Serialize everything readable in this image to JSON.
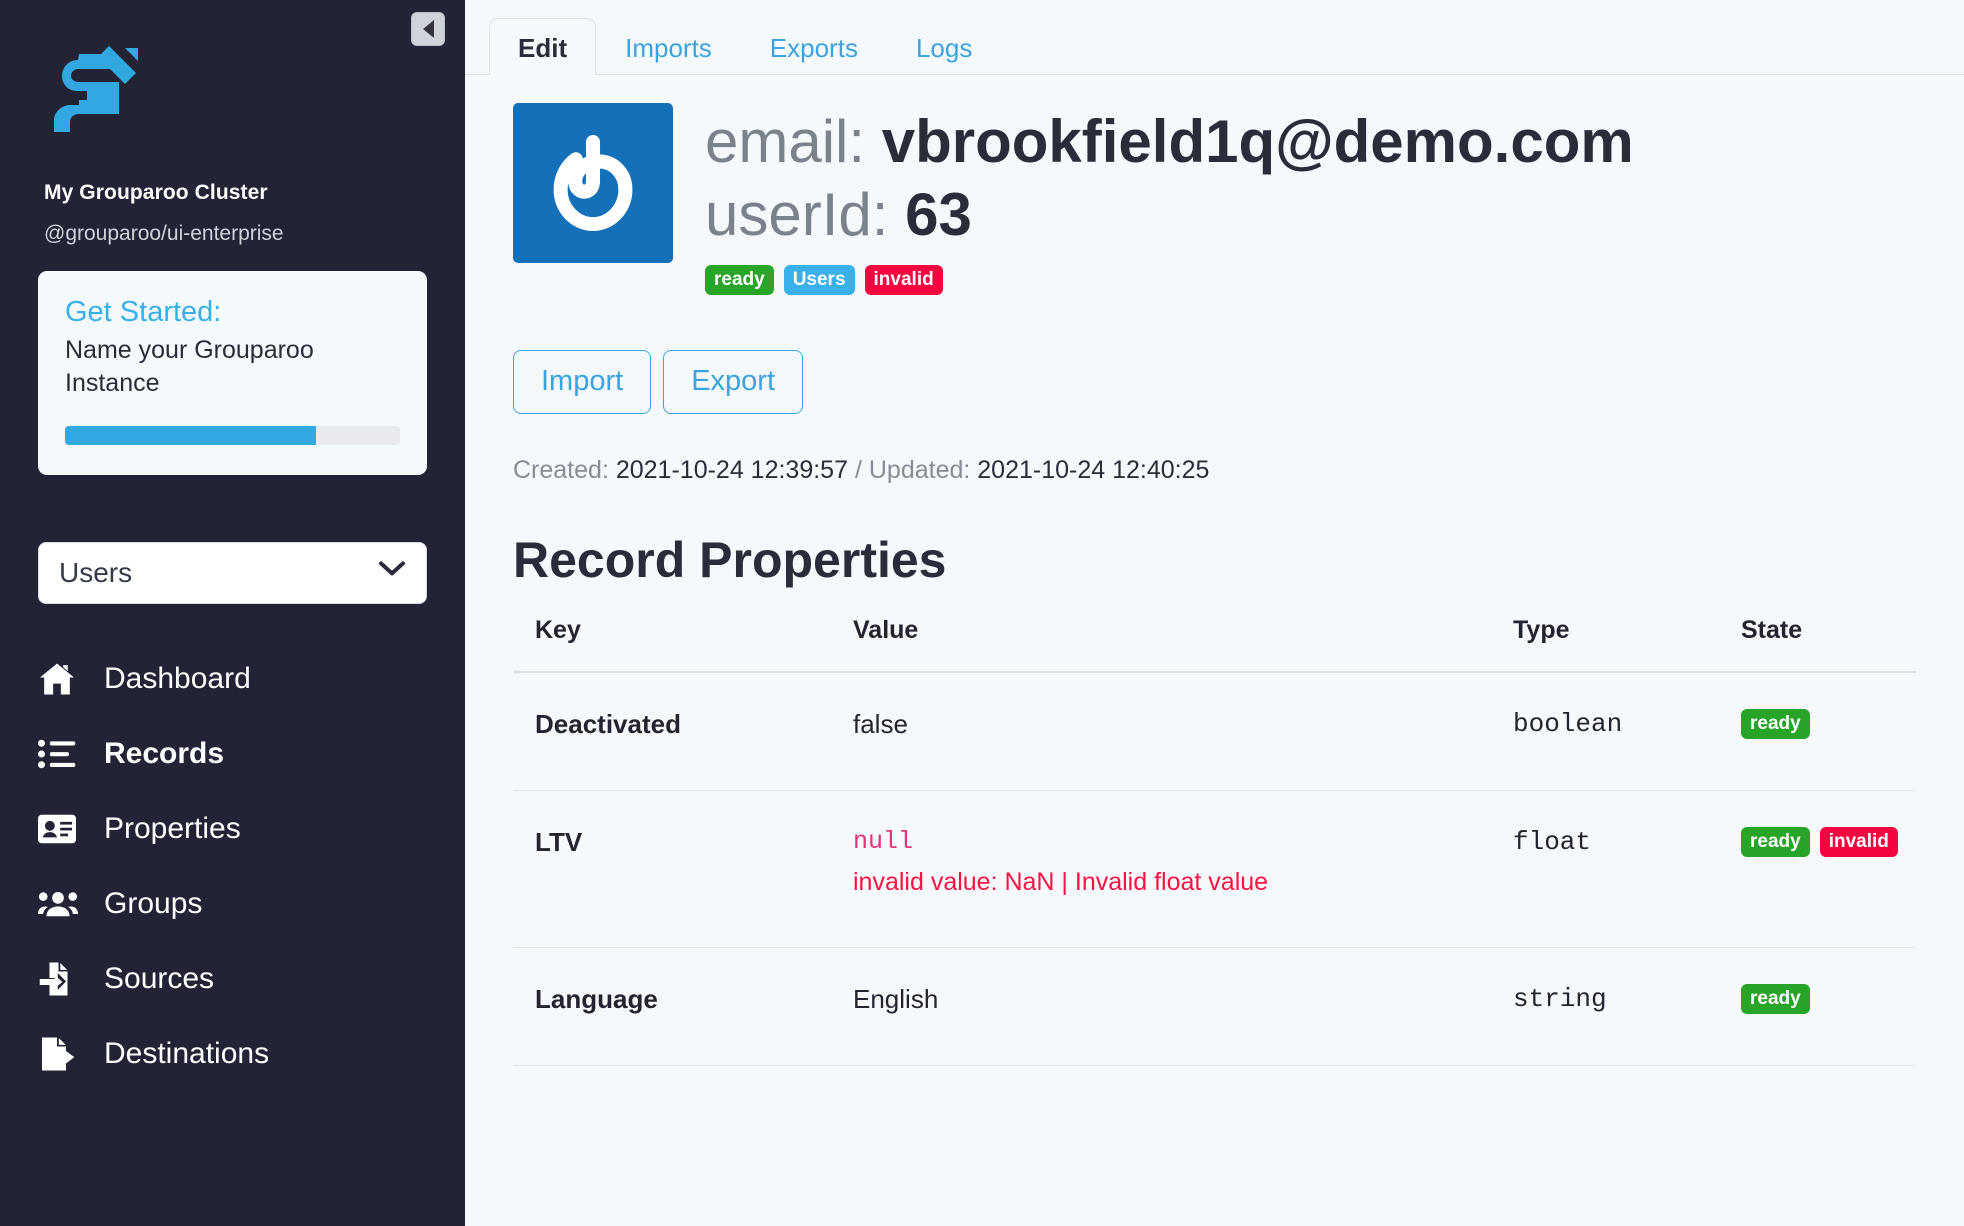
{
  "sidebar": {
    "collapse_button_label": "collapse-sidebar",
    "logo_name": "grouparoo-logo",
    "cluster_name": "My Grouparoo Cluster",
    "package_name": "@grouparoo/ui-enterprise",
    "get_started": {
      "title": "Get Started:",
      "step_text": "Name your Grouparoo Instance",
      "progress_percent": 75
    },
    "model_select": {
      "selected": "Users",
      "options": [
        "Users"
      ]
    },
    "nav_items": [
      {
        "label": "Dashboard",
        "icon": "home-icon",
        "active": false
      },
      {
        "label": "Records",
        "icon": "list-icon",
        "active": true
      },
      {
        "label": "Properties",
        "icon": "id-card-icon",
        "active": false
      },
      {
        "label": "Groups",
        "icon": "users-icon",
        "active": false
      },
      {
        "label": "Sources",
        "icon": "file-import-icon",
        "active": false
      },
      {
        "label": "Destinations",
        "icon": "file-export-icon",
        "active": false
      }
    ]
  },
  "main": {
    "tabs": [
      {
        "label": "Edit",
        "active": true
      },
      {
        "label": "Imports",
        "active": false
      },
      {
        "label": "Exports",
        "active": false
      },
      {
        "label": "Logs",
        "active": false
      }
    ],
    "record": {
      "avatar_icon": "gravatar-icon",
      "email_label": "email:",
      "email_value": "vbrookfield1q@demo.com",
      "userid_label": "userId:",
      "userid_value": "63",
      "badges": [
        {
          "text": "ready",
          "color": "#28a428"
        },
        {
          "text": "Users",
          "color": "#3ab0e8"
        },
        {
          "text": "invalid",
          "color": "#f5053f"
        }
      ]
    },
    "buttons": {
      "import_label": "Import",
      "export_label": "Export"
    },
    "timestamps": {
      "created_label": "Created:",
      "created_value": "2021-10-24 12:39:57",
      "separator": "/",
      "updated_label": "Updated:",
      "updated_value": "2021-10-24 12:40:25"
    },
    "properties_section": {
      "title": "Record Properties",
      "columns": [
        "Key",
        "Value",
        "Type",
        "State"
      ],
      "rows": [
        {
          "key": "Deactivated",
          "value": "false",
          "value_mono": false,
          "error": "",
          "type": "boolean",
          "states": [
            {
              "text": "ready",
              "color": "#28a428"
            }
          ]
        },
        {
          "key": "LTV",
          "value": "null",
          "value_mono": true,
          "error": "invalid value: NaN | Invalid float value",
          "type": "float",
          "states": [
            {
              "text": "ready",
              "color": "#28a428"
            },
            {
              "text": "invalid",
              "color": "#f5053f"
            }
          ]
        },
        {
          "key": "Language",
          "value": "English",
          "value_mono": false,
          "error": "",
          "type": "string",
          "states": [
            {
              "text": "ready",
              "color": "#28a428"
            }
          ]
        }
      ]
    }
  }
}
